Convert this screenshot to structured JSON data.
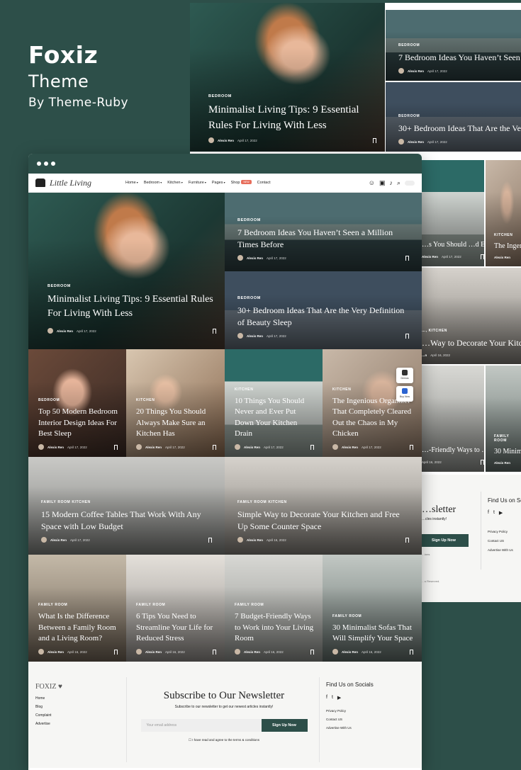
{
  "brand": {
    "title": "Foxiz",
    "subtitle": "Theme",
    "byline": "By Theme-Ruby"
  },
  "nav": {
    "logo": "Little Living",
    "menu": [
      "Home",
      "Bedroom",
      "Kitchen",
      "Furniture",
      "Pages",
      "Shop",
      "Contact"
    ],
    "shop_badge": "NEW"
  },
  "side": {
    "demos": "Demos",
    "buy": "Buy Now"
  },
  "posts": {
    "p1": {
      "cat": "BEDROOM",
      "title": "Minimalist Living Tips: 9 Essential Rules For Living With Less",
      "author": "Alexis Ren",
      "date": "April 17, 2022"
    },
    "p2": {
      "cat": "BEDROOM",
      "title": "7 Bedroom Ideas You Haven’t Seen a Million Times Before",
      "author": "Alexis Ren",
      "date": "April 17, 2022"
    },
    "p3": {
      "cat": "BEDROOM",
      "title": "30+ Bedroom Ideas That Are the Very Definition of Beauty Sleep",
      "author": "Alexis Ren",
      "date": "April 17, 2022"
    },
    "p4": {
      "cat": "BEDROOM",
      "title": "Top 50 Modern Bedroom Interior Design Ideas For Best Sleep",
      "author": "Alexis Ren",
      "date": "April 17, 2022"
    },
    "p5": {
      "cat": "KITCHEN",
      "title": "20 Things You Should Always Make Sure an Kitchen Has",
      "author": "Alexis Ren",
      "date": "April 17, 2022"
    },
    "p6": {
      "cat": "KITCHEN",
      "title": "10 Things You Should Never and Ever Put Down Your Kitchen Drain",
      "author": "Alexis Ren",
      "date": "April 17, 2022"
    },
    "p7": {
      "cat": "KITCHEN",
      "title": "The Ingenious Organizer That Completely Cleared Out the Chaos in My Chicken",
      "author": "Alexis Ren",
      "date": "April 17, 2022"
    },
    "p8": {
      "cat": "FAMILY ROOM  KITCHEN",
      "title": "15 Modern Coffee Tables That Work With Any Space with Low Budget",
      "author": "Alexis Ren",
      "date": "April 17, 2022"
    },
    "p9": {
      "cat": "FAMILY ROOM  KITCHEN",
      "title": "Simple Way to Decorate Your Kitchen and Free Up Some Counter Space",
      "author": "Alexis Ren",
      "date": "April 16, 2022"
    },
    "p10": {
      "cat": "FAMILY ROOM",
      "title": "What Is the Difference Between a Family Room and a Living Room?",
      "author": "Alexis Ren",
      "date": "April 16, 2022"
    },
    "p11": {
      "cat": "FAMILY ROOM",
      "title": "6 Tips You Need to Streamline Your Life for Reduced Stress",
      "author": "Alexis Ren",
      "date": "April 16, 2022"
    },
    "p12": {
      "cat": "FAMILY ROOM",
      "title": "7 Budget-Friendly Ways to Work into Your Living Room",
      "author": "Alexis Ren",
      "date": "April 16, 2022"
    },
    "p13": {
      "cat": "FAMILY ROOM",
      "title": "30 Minimalist Sofas That Will Simplify Your Space",
      "author": "Alexis Ren",
      "date": "April 16, 2022"
    }
  },
  "back": {
    "b1": {
      "cat": "BEDROOM",
      "title": "Minimalist Living Tips: 9 Essential Rules For Living With Less",
      "author": "Alexis Ren",
      "date": "April 17, 2022"
    },
    "b2": {
      "cat": "BEDROOM",
      "title": "7 Bedroom Ideas You Haven’t Seen a Million Times Before",
      "author": "Alexis Ren",
      "date": "April 17, 2022"
    },
    "b3": {
      "cat": "BEDROOM",
      "title": "30+ Bedroom Ideas That Are the Very Definition of Beauty Sleep",
      "author": "Alexis Ren",
      "date": "April 17, 2022"
    },
    "b4": {
      "title": "…s You Should …d Ever Put Down …chen Drain",
      "author": "Alexis Ren",
      "date": "April 17, 2022"
    },
    "b5": {
      "cat": "KITCHEN",
      "title": "The Ingenious Organizer That Completely Cleared Out the Chaos in My Chicken",
      "author": "Alexis Ren"
    },
    "b6": {
      "cat": "…, KITCHEN",
      "title": "…Way to Decorate Your Kitchen and Free Up Some Counter Space",
      "author": "…n",
      "date": "April 16, 2022"
    },
    "b7": {
      "title": "…-Friendly Ways to …o Your Living",
      "date": "April 16, 2022"
    },
    "b8": {
      "cat": "FAMILY ROOM",
      "title": "30 Minimalist Sofas That Will Simplify Your Space",
      "author": "Alexis Ren"
    },
    "newsletter": "…sletter",
    "nl_sub": "…cles instantly!",
    "signup": "Sign Up Now",
    "find": "Find Us on Socials",
    "links": [
      "Privacy Policy",
      "Contact US",
      "Advertise With Us"
    ],
    "reserved": "…s Reserved.",
    "fragment": "…ions"
  },
  "footer": {
    "logo": "FOXIZ",
    "links": [
      "Home",
      "Blog",
      "Complaint",
      "Advertise"
    ],
    "nl_title": "Subscribe to Our Newsletter",
    "nl_sub": "Subscribe to our newsletter to get our newest articles instantly!",
    "email_placeholder": "Your email address",
    "signup": "Sign Up Now",
    "agree": "I have read and agree to the terms & conditions",
    "find": "Find Us on Socials",
    "social": [
      "f",
      "t",
      "▶"
    ],
    "flinks": [
      "Privacy Policy",
      "Contact US",
      "Advertise With Us"
    ]
  }
}
